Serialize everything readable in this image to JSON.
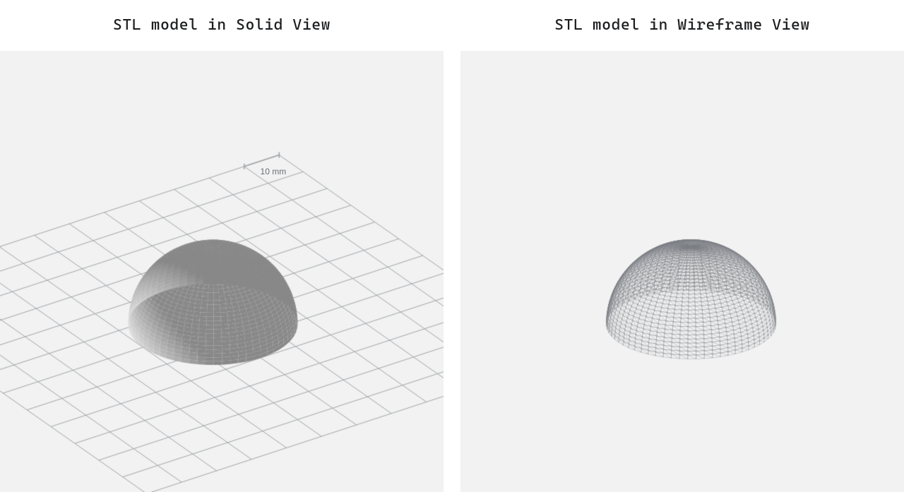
{
  "left": {
    "title": "STL model in Solid View",
    "scale_label": "10 mm"
  },
  "right": {
    "title": "STL model in Wireframe View"
  },
  "model": {
    "shape": "hemisphere",
    "radius_mm": 20,
    "segments_longitude": 64,
    "segments_latitude": 32,
    "grid_spacing_mm": 10,
    "grid_extent_cells": 6
  },
  "colors": {
    "viewport_bg": "#f2f2f2",
    "solid_base": "#9d9d9d",
    "solid_highlight": "#ffffff",
    "solid_dark": "#5e5e5e",
    "grid_line": "#a0a4a8",
    "wire_line": "#7b7f83",
    "scale_text": "#6a6e72"
  }
}
